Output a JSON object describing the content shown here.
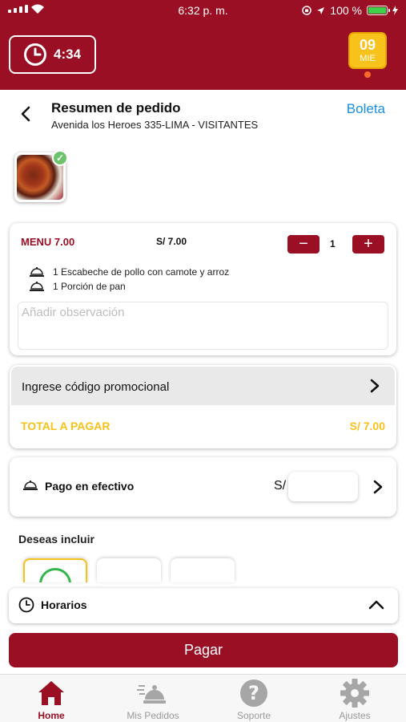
{
  "status_bar": {
    "time": "6:32 p. m.",
    "battery": "100 %"
  },
  "header": {
    "timer": "4:34",
    "date_day": "09",
    "date_weekday": "MIE",
    "colors": {
      "brand": "#9a0f24",
      "accent": "#f6c21b"
    }
  },
  "page": {
    "title": "Resumen de pedido",
    "address": "Avenida los Heroes 335-LIMA - VISITANTES",
    "boleta_link": "Boleta"
  },
  "order": {
    "menu_name": "MENU 7.00",
    "menu_price": "S/ 7.00",
    "quantity": "1",
    "minus_label": "−",
    "plus_label": "+",
    "items": [
      {
        "text": "1 Escabeche de pollo con camote y arroz",
        "icon": "dish-icon"
      },
      {
        "text": "1 Porción de pan",
        "icon": "dish-icon"
      }
    ],
    "observation_placeholder": "Añadir observación"
  },
  "promo": {
    "label": "Ingrese código promocional",
    "total_label": "TOTAL A PAGAR",
    "total_value": "S/ 7.00"
  },
  "payment": {
    "label": "Pago en efectivo",
    "currency": "S/",
    "amount_value": ""
  },
  "include": {
    "label": "Deseas incluir"
  },
  "horarios": {
    "label": "Horarios"
  },
  "pay_button": "Pagar",
  "tabbar": [
    {
      "label": "Home",
      "icon": "home-icon",
      "active": true
    },
    {
      "label": "Mis Pedidos",
      "icon": "delivery-icon",
      "active": false
    },
    {
      "label": "Soporte",
      "icon": "question-icon",
      "active": false
    },
    {
      "label": "Ajustes",
      "icon": "gear-icon",
      "active": false
    }
  ]
}
